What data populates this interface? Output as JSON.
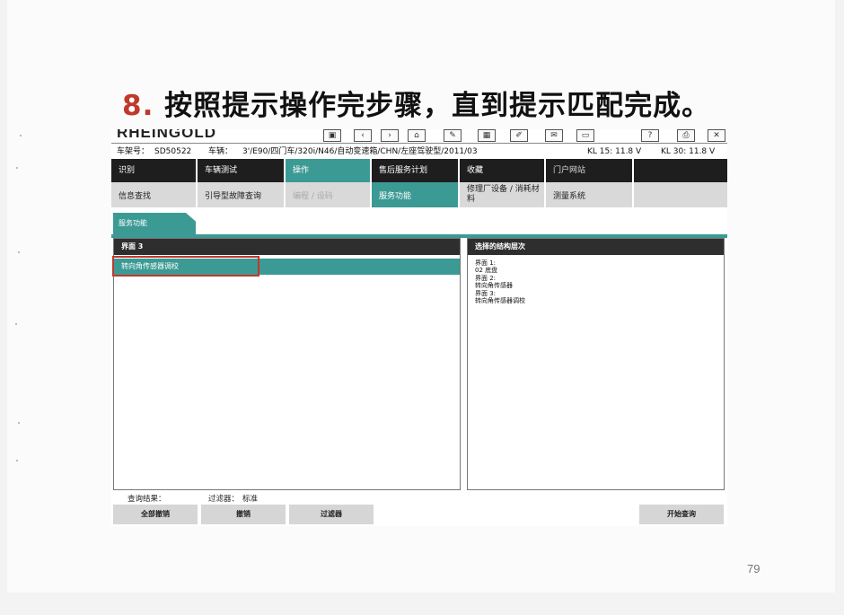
{
  "page": {
    "heading_number": "8.",
    "heading_text": "按照提示操作完步骤，直到提示匹配完成。",
    "page_number": "79"
  },
  "app": {
    "brand": "RHEINGOLD",
    "toolbar_icons": [
      "save-icon",
      "back-icon",
      "forward-icon",
      "home-icon",
      "tool-icon",
      "grid-icon",
      "edit-icon",
      "mail-icon",
      "window-icon",
      "help-icon",
      "print-icon",
      "close-icon"
    ],
    "toolbar_glyphs": [
      "▣",
      "‹",
      "›",
      "⌂",
      "✎",
      "▦",
      "✐",
      "✉",
      "▭",
      "?",
      "⎙",
      "✕"
    ]
  },
  "infobar": {
    "vin_label": "车架号：",
    "vin_value": "SD50522",
    "vehicle_label": "车辆：",
    "vehicle_value": "3'/E90/四门车/320i/N46/自动变速箱/CHN/左座驾驶型/2011/03",
    "kl15": "KL 15:  11.8 V",
    "kl30": "KL 30:  11.8 V"
  },
  "menu1": {
    "items": [
      {
        "label": "识别"
      },
      {
        "label": "车辆测试"
      },
      {
        "label": "操作"
      },
      {
        "label": "售后服务计划"
      },
      {
        "label": "收藏"
      },
      {
        "label": "门户网站"
      },
      {
        "label": ""
      }
    ]
  },
  "menu2": {
    "items": [
      {
        "label": "信息查找"
      },
      {
        "label": "引导型故障查询"
      },
      {
        "label": "编程 / 设码"
      },
      {
        "label": "服务功能"
      },
      {
        "label": "修理厂设备 / 消耗材料"
      },
      {
        "label": "测量系统"
      },
      {
        "label": ""
      }
    ]
  },
  "tab": {
    "label": "服务功能"
  },
  "left_panel": {
    "header": "界面 3",
    "selected_row": "转向角传感器调校"
  },
  "right_panel": {
    "header": "选择的结构层次",
    "lines": [
      "界面 1:",
      "02 底盘",
      "界面 2:",
      "转向角传感器",
      "界面 3:",
      "转向角传感器调校"
    ]
  },
  "status": {
    "result_label": "查询结果：",
    "filter_label": "过滤器：",
    "filter_value": "标准"
  },
  "buttons": {
    "deselect_all": "全部撤销",
    "deselect": "撤销",
    "filter": "过滤器",
    "start_search": "开始查询"
  }
}
